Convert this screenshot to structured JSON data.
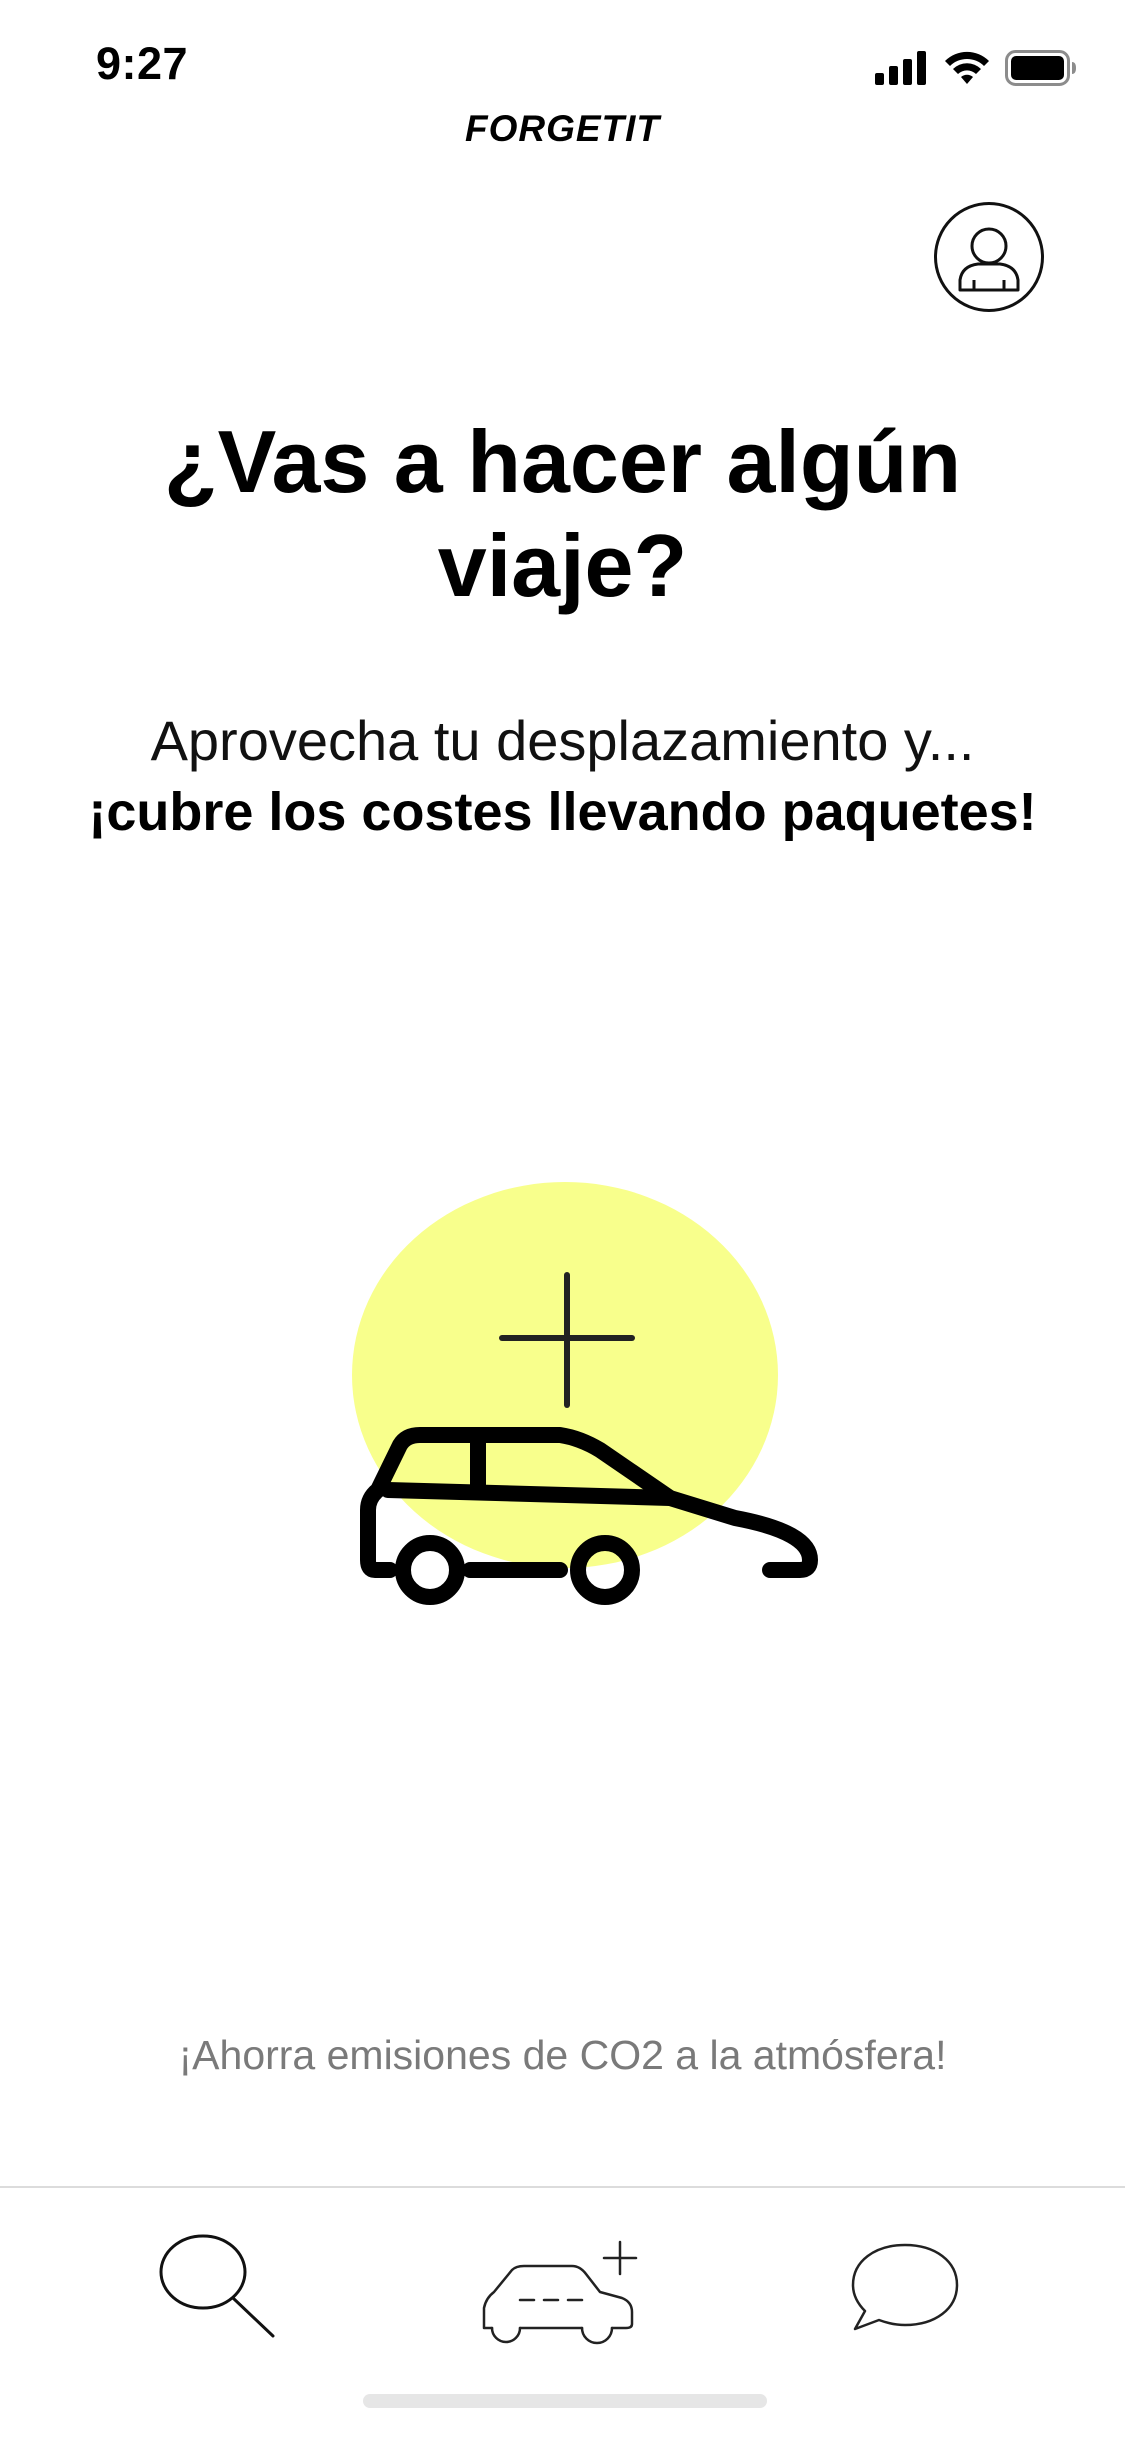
{
  "status_bar": {
    "time": "9:27",
    "icons": [
      "cellular-signal-icon",
      "wifi-icon",
      "battery-icon"
    ]
  },
  "header": {
    "logo": "FORGETIT",
    "profile_icon": "user-icon"
  },
  "main": {
    "headline": "¿Vas a hacer algún viaje?",
    "subtitle_line1": "Aprovecha tu desplazamiento y...",
    "subtitle_line2": "¡cubre los costes llevando paquetes!",
    "illustration_icons": [
      "plus-icon",
      "car-icon"
    ],
    "accent_color": "#F8FF8C"
  },
  "footer_note": "¡Ahorra emisiones de CO2 a la atmósfera!",
  "tab_bar": {
    "tabs": [
      {
        "id": "search",
        "icon": "search-icon"
      },
      {
        "id": "add-trip",
        "icon": "car-plus-icon"
      },
      {
        "id": "messages",
        "icon": "chat-bubble-icon"
      }
    ]
  }
}
